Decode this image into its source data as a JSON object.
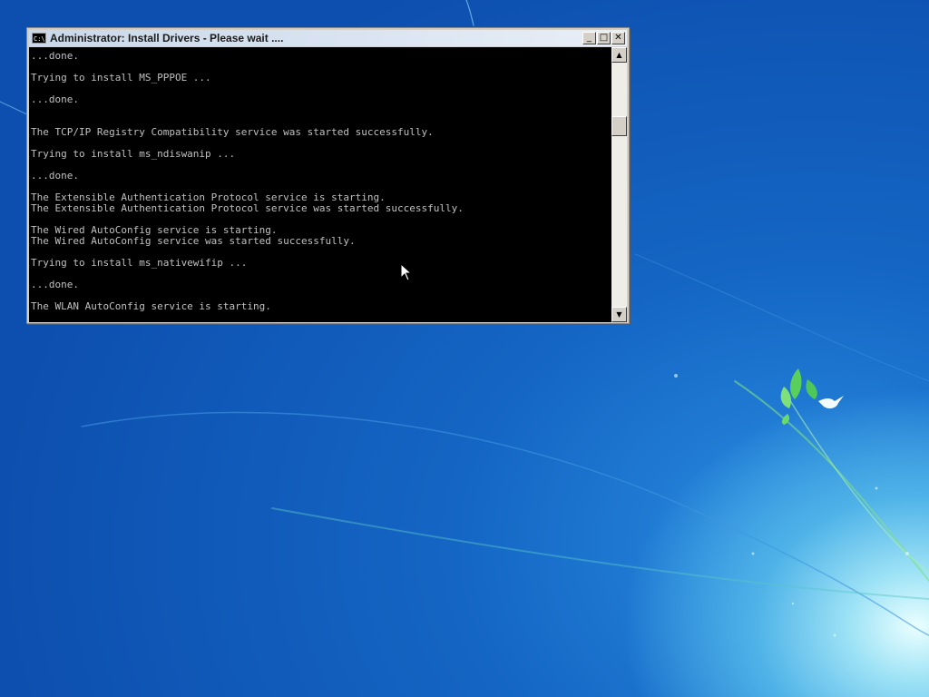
{
  "window": {
    "title": "Administrator:  Install Drivers - Please wait ....",
    "icon_label": "C:\\.",
    "controls": {
      "minimize": "_",
      "maximize": "□",
      "close": "✕"
    }
  },
  "console": {
    "text": "...done.\n\nTrying to install MS_PPPOE ...\n\n...done.\n\n\nThe TCP/IP Registry Compatibility service was started successfully.\n\nTrying to install ms_ndiswanip ...\n\n...done.\n\nThe Extensible Authentication Protocol service is starting.\nThe Extensible Authentication Protocol service was started successfully.\n\nThe Wired AutoConfig service is starting.\nThe Wired AutoConfig service was started successfully.\n\nTrying to install ms_nativewifip ...\n\n...done.\n\nThe WLAN AutoConfig service is starting."
  },
  "scrollbar": {
    "up_arrow": "▲",
    "down_arrow": "▼"
  },
  "colors": {
    "console_bg": "#000000",
    "console_text": "#c0c0c0",
    "desktop_blue": "#1465c4"
  },
  "icons": [
    "cmd-app-icon",
    "minimize-icon",
    "maximize-icon",
    "close-icon",
    "mouse-pointer-icon",
    "leaf-icon",
    "bird-icon"
  ]
}
